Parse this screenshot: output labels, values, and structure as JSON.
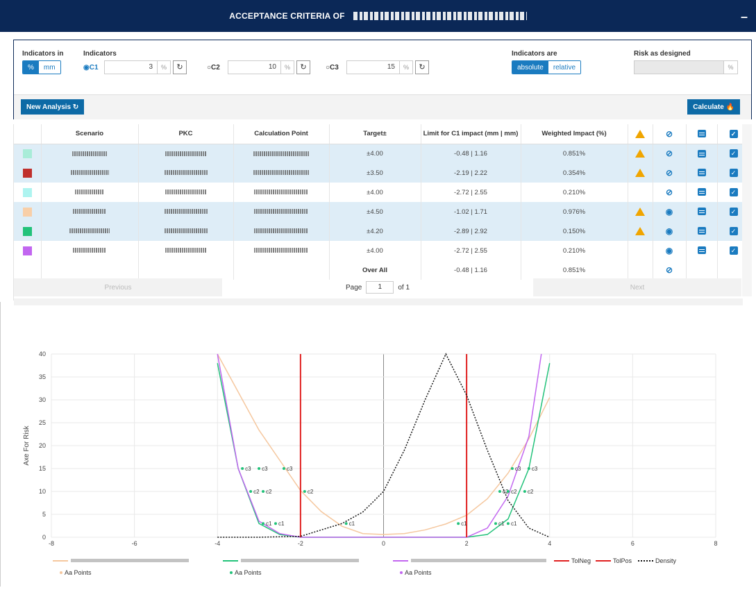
{
  "header": {
    "title": "ACCEPTANCE CRITERIA OF",
    "minimize_label": "–"
  },
  "controls": {
    "indicators_in_label": "Indicators in",
    "units": [
      "%",
      "mm"
    ],
    "units_selected": "%",
    "indicators_label": "Indicators",
    "indicators": [
      {
        "label": "C1",
        "value": "3",
        "unit": "%",
        "selected": true
      },
      {
        "label": "C2",
        "value": "10",
        "unit": "%",
        "selected": false
      },
      {
        "label": "C3",
        "value": "15",
        "unit": "%",
        "selected": false
      }
    ],
    "indicators_are_label": "Indicators are",
    "modes": [
      "absolute",
      "relative"
    ],
    "mode_selected": "absolute",
    "risk_label": "Risk as designed",
    "risk_unit": "%",
    "new_analysis_label": "New Analysis",
    "calculate_label": "Calculate"
  },
  "table": {
    "columns": [
      "Scenario",
      "PKC",
      "Calculation Point",
      "Target±",
      "Limit for C1 impact (mm | mm)",
      "Weighted Impact (%)"
    ],
    "rows": [
      {
        "color": "#a8ecd8",
        "target": "±4.00",
        "limit": "-0.48 | 1.16",
        "impact": "0.851%",
        "warn": true,
        "visible": false,
        "highlight": true
      },
      {
        "color": "#c0302c",
        "target": "±3.50",
        "limit": "-2.19 | 2.22",
        "impact": "0.354%",
        "warn": true,
        "visible": false,
        "highlight": true
      },
      {
        "color": "#aef4f0",
        "target": "±4.00",
        "limit": "-2.72 | 2.55",
        "impact": "0.210%",
        "warn": false,
        "visible": false,
        "highlight": false
      },
      {
        "color": "#f8cfa8",
        "target": "±4.50",
        "limit": "-1.02 | 1.71",
        "impact": "0.976%",
        "warn": true,
        "visible": true,
        "highlight": true
      },
      {
        "color": "#22c27a",
        "target": "±4.20",
        "limit": "-2.89 | 2.92",
        "impact": "0.150%",
        "warn": true,
        "visible": true,
        "highlight": true
      },
      {
        "color": "#c266f0",
        "target": "±4.00",
        "limit": "-2.72 | 2.55",
        "impact": "0.210%",
        "warn": false,
        "visible": true,
        "highlight": false
      }
    ],
    "overall": {
      "label": "Over All",
      "limit": "-0.48 | 1.16",
      "impact": "0.851%"
    }
  },
  "pager": {
    "prev": "Previous",
    "page_label": "Page",
    "page": "1",
    "of": "of 1",
    "next": "Next"
  },
  "chart_data": {
    "type": "line",
    "ylabel": "Axe For Risk",
    "xlim": [
      -8,
      8
    ],
    "ylim": [
      0,
      40
    ],
    "xticks": [
      -8,
      -6,
      -4,
      -2,
      0,
      2,
      4,
      6,
      8
    ],
    "yticks": [
      0,
      5,
      10,
      15,
      20,
      25,
      30,
      35,
      40
    ],
    "series": [
      {
        "color": "#f5c79e",
        "x": [
          -4,
          -3,
          -2.5,
          -2,
          -1.5,
          -1,
          -0.5,
          0,
          0.5,
          1,
          1.5,
          2,
          2.5,
          3,
          3.5,
          4
        ],
        "y": [
          40,
          23.4,
          16.8,
          10.2,
          5.6,
          2.4,
          0.8,
          0.6,
          0.8,
          1.6,
          2.9,
          4.8,
          8.4,
          14,
          21.5,
          30.5
        ]
      },
      {
        "color": "#22c27a",
        "x": [
          -4,
          -3.5,
          -3,
          -2.5,
          -2,
          -1.5,
          1.5,
          2,
          2.5,
          3,
          3.5,
          4
        ],
        "y": [
          38,
          15,
          3,
          0.6,
          0,
          0,
          0,
          0,
          0.6,
          4,
          15,
          38
        ]
      },
      {
        "color": "#c266f0",
        "x": [
          -4,
          -3.5,
          -3,
          -2.5,
          -2,
          2,
          2.5,
          3,
          3.5,
          3.8
        ],
        "y": [
          40,
          15,
          3.5,
          0.8,
          0,
          0,
          2,
          9,
          22,
          40
        ]
      },
      {
        "name": "TolNeg",
        "color": "#e02020",
        "x": [
          -2,
          -2
        ],
        "y": [
          0,
          40
        ]
      },
      {
        "name": "TolPos",
        "color": "#e02020",
        "x": [
          2,
          2
        ],
        "y": [
          0,
          40
        ]
      },
      {
        "name": "Density",
        "color": "#111111",
        "x": [
          -4,
          -3,
          -2,
          -1,
          -0.5,
          0,
          0.5,
          1,
          1.5,
          2,
          2.5,
          3,
          3.5,
          4
        ],
        "y": [
          0,
          0,
          0.2,
          3,
          5.5,
          10,
          19,
          30,
          40,
          31,
          19,
          8,
          2,
          0
        ]
      }
    ],
    "point_labels": [
      {
        "x": -3.4,
        "y": 15,
        "t": "c3"
      },
      {
        "x": -3.0,
        "y": 15,
        "t": "c3"
      },
      {
        "x": -2.4,
        "y": 15,
        "t": "c3"
      },
      {
        "x": -3.2,
        "y": 10,
        "t": "c2"
      },
      {
        "x": -2.9,
        "y": 10,
        "t": "c2"
      },
      {
        "x": -1.9,
        "y": 10,
        "t": "c2"
      },
      {
        "x": -2.9,
        "y": 3,
        "t": "c1"
      },
      {
        "x": -2.6,
        "y": 3,
        "t": "c1"
      },
      {
        "x": -0.9,
        "y": 3,
        "t": "c1"
      },
      {
        "x": 1.8,
        "y": 3,
        "t": "c1"
      },
      {
        "x": 2.7,
        "y": 3,
        "t": "c1"
      },
      {
        "x": 3.0,
        "y": 3,
        "t": "c1"
      },
      {
        "x": 2.8,
        "y": 10,
        "t": "c2"
      },
      {
        "x": 3.0,
        "y": 10,
        "t": "c2"
      },
      {
        "x": 3.4,
        "y": 10,
        "t": "c2"
      },
      {
        "x": 3.1,
        "y": 15,
        "t": "c3"
      },
      {
        "x": 3.5,
        "y": 15,
        "t": "c3"
      }
    ],
    "legend": [
      {
        "label": "TolNeg",
        "color": "#e02020",
        "style": "solid"
      },
      {
        "label": "TolPos",
        "color": "#e02020",
        "style": "solid"
      },
      {
        "label": "Density",
        "color": "#111111",
        "style": "dotted"
      }
    ],
    "legend_points": {
      "label": "Points",
      "prefix": "Aa"
    }
  }
}
